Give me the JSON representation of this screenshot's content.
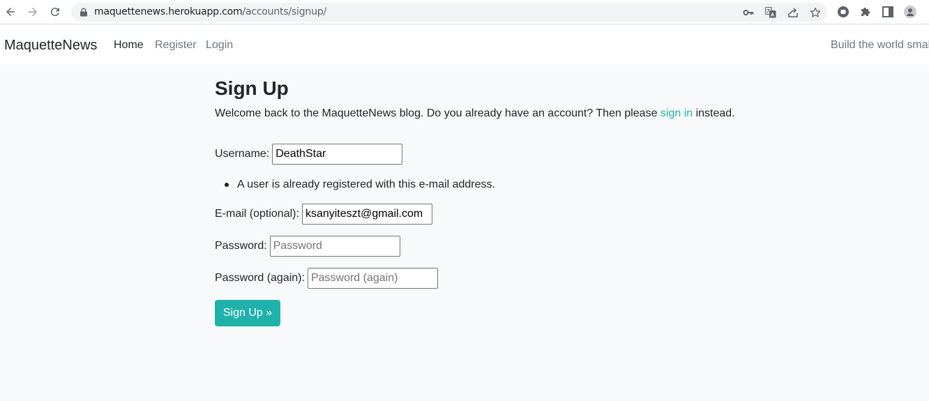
{
  "browser": {
    "url_host": "maquettenews.herokuapp.com",
    "url_path": "/accounts/signup/"
  },
  "navbar": {
    "brand": "MaquetteNews",
    "links": [
      {
        "label": "Home",
        "active": true
      },
      {
        "label": "Register",
        "active": false
      },
      {
        "label": "Login",
        "active": false
      }
    ],
    "tagline": "Build the world smal"
  },
  "page": {
    "title": "Sign Up",
    "lead_before": "Welcome back to the MaquetteNews blog. Do you already have an account? Then please ",
    "lead_link": "sign in",
    "lead_after": " instead."
  },
  "form": {
    "username": {
      "label": "Username:",
      "value": "DeathStar",
      "placeholder": ""
    },
    "errors": [
      "A user is already registered with this e-mail address."
    ],
    "email": {
      "label": "E-mail (optional):",
      "value": "ksanyiteszt@gmail.com",
      "placeholder": ""
    },
    "password": {
      "label": "Password:",
      "value": "",
      "placeholder": "Password"
    },
    "password2": {
      "label": "Password (again):",
      "value": "",
      "placeholder": "Password (again)"
    },
    "submit_label": "Sign Up »"
  },
  "colors": {
    "accent": "#20b2aa",
    "page_bg": "#f8f9fa",
    "navbar_bg": "#ffffff",
    "text": "#212529",
    "muted": "#6c757d"
  }
}
